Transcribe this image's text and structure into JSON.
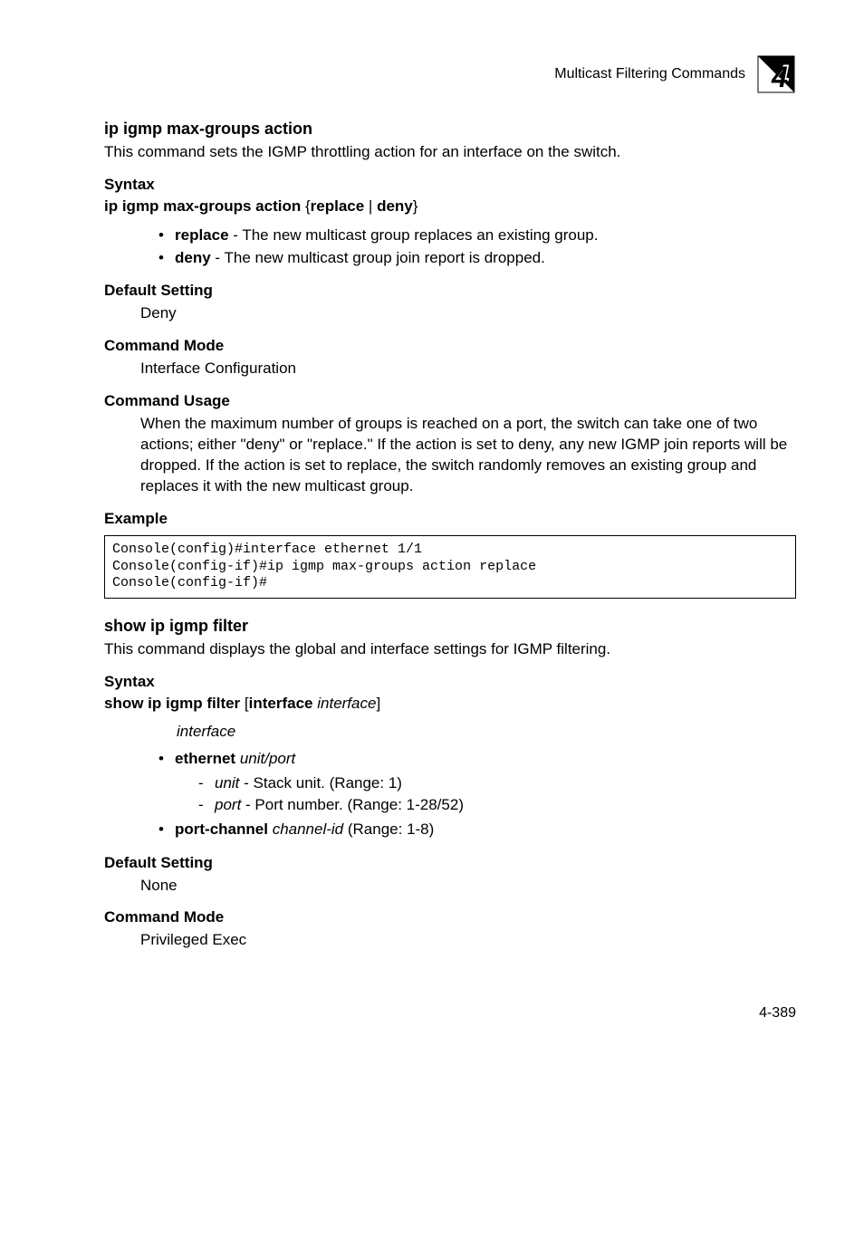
{
  "header": {
    "title": "Multicast Filtering Commands",
    "chapter_number": "4"
  },
  "section1": {
    "heading": "ip igmp max-groups action",
    "description": "This command sets the IGMP throttling action for an interface on the switch.",
    "syntax": {
      "label": "Syntax",
      "command_bold1": "ip igmp max-groups action",
      "command_sep1": " {",
      "command_bold2": "replace",
      "command_sep2": " | ",
      "command_bold3": "deny",
      "command_sep3": "}",
      "bullets": [
        {
          "term": "replace",
          "desc": " - The new multicast group replaces an existing group."
        },
        {
          "term": "deny",
          "desc": " - The new multicast group join report is dropped."
        }
      ]
    },
    "default_setting": {
      "label": "Default Setting",
      "value": "Deny"
    },
    "command_mode": {
      "label": "Command Mode",
      "value": "Interface Configuration"
    },
    "command_usage": {
      "label": "Command Usage",
      "text": "When the maximum number of groups is reached on a port, the switch can take one of two actions; either \"deny\" or \"replace.\" If the action is set to deny, any new IGMP join reports will be dropped. If the action is set to replace, the switch randomly removes an existing group and replaces it with the new multicast group."
    },
    "example": {
      "label": "Example",
      "code": "Console(config)#interface ethernet 1/1\nConsole(config-if)#ip igmp max-groups action replace\nConsole(config-if)#"
    }
  },
  "section2": {
    "heading": "show ip igmp filter",
    "description": "This command displays the global and interface settings for IGMP filtering.",
    "syntax": {
      "label": "Syntax",
      "cmd_b1": "show ip igmp filter",
      "cmd_s1": " [",
      "cmd_b2": "interface",
      "cmd_s2": " ",
      "cmd_i1": "interface",
      "cmd_s3": "]",
      "interface_label": "interface",
      "eth_prefix": "ethernet",
      "eth_unit": "unit",
      "eth_slash": "/",
      "eth_port": "port",
      "unit_term": "unit",
      "unit_desc": " - Stack unit. (Range: 1)",
      "port_term": "port",
      "port_desc": " - Port number. (Range: 1-28/52)",
      "pc_prefix": "port-channel",
      "pc_term": "channel-id",
      "pc_desc": " (Range: 1-8)"
    },
    "default_setting": {
      "label": "Default Setting",
      "value": "None"
    },
    "command_mode": {
      "label": "Command Mode",
      "value": "Privileged Exec"
    }
  },
  "page_number": "4-389"
}
